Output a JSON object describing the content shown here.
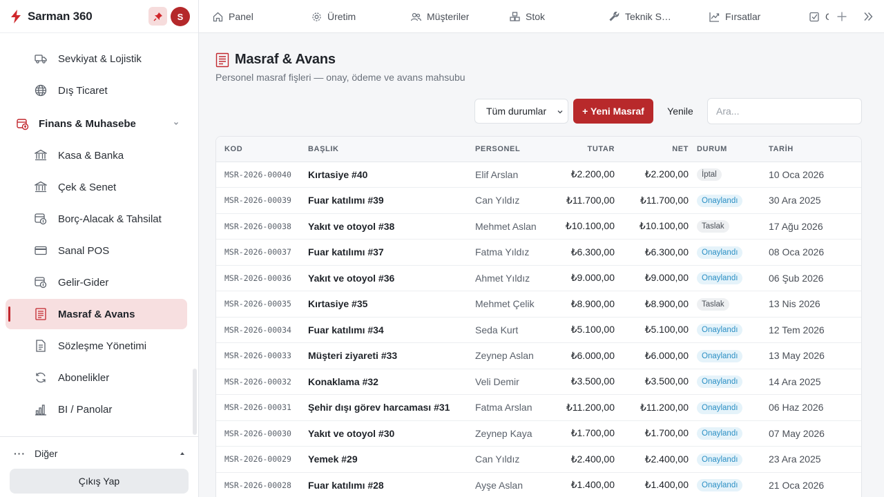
{
  "brand": {
    "name": "Sarman 360",
    "avatar_initial": "S"
  },
  "sidebar": {
    "items": [
      {
        "label": "Sevkiyat & Lojistik",
        "icon": "truck-icon"
      },
      {
        "label": "Dış Ticaret",
        "icon": "globe-icon"
      }
    ],
    "section": {
      "label": "Finans & Muhasebe",
      "icon": "finance-icon"
    },
    "sub_items": [
      {
        "label": "Kasa & Banka",
        "icon": "bank-icon"
      },
      {
        "label": "Çek & Senet",
        "icon": "bank-icon"
      },
      {
        "label": "Borç-Alacak & Tahsilat",
        "icon": "finance-icon"
      },
      {
        "label": "Sanal POS",
        "icon": "card-icon"
      },
      {
        "label": "Gelir-Gider",
        "icon": "finance-icon"
      },
      {
        "label": "Masraf & Avans",
        "icon": "receipt-icon",
        "active": true
      },
      {
        "label": "Sözleşme Yönetimi",
        "icon": "document-icon"
      },
      {
        "label": "Abonelikler",
        "icon": "refresh-icon"
      },
      {
        "label": "BI / Panolar",
        "icon": "bar-chart-icon"
      }
    ],
    "more_label": "Diğer",
    "logout_label": "Çıkış Yap"
  },
  "topbar": {
    "tabs": [
      {
        "label": "Panel",
        "icon": "home-icon"
      },
      {
        "label": "Üretim",
        "icon": "gear-icon"
      },
      {
        "label": "Müşteriler",
        "icon": "users-icon"
      },
      {
        "label": "Stok",
        "icon": "boxes-icon"
      },
      {
        "label": "Teknik S…",
        "icon": "wrench-icon"
      },
      {
        "label": "Fırsatlar",
        "icon": "trend-icon"
      },
      {
        "label": "G",
        "icon": "checkbox-icon"
      }
    ]
  },
  "page": {
    "title": "Masraf & Avans",
    "subtitle": "Personel masraf fişleri — onay, ödeme ve avans mahsubu",
    "filter_value": "Tüm durumlar",
    "new_button": "+ Yeni Masraf",
    "refresh_button": "Yenile",
    "search_placeholder": "Ara..."
  },
  "table": {
    "headers": [
      "KOD",
      "BAŞLIK",
      "PERSONEL",
      "TUTAR",
      "NET",
      "DURUM",
      "TARİH"
    ],
    "rows": [
      {
        "kod": "MSR-2026-00040",
        "baslik": "Kırtasiye #40",
        "personel": "Elif Arslan",
        "tutar": "₺2.200,00",
        "net": "₺2.200,00",
        "durum": "İptal",
        "tarih": "10 Oca 2026"
      },
      {
        "kod": "MSR-2026-00039",
        "baslik": "Fuar katılımı #39",
        "personel": "Can Yıldız",
        "tutar": "₺11.700,00",
        "net": "₺11.700,00",
        "durum": "Onaylandı",
        "tarih": "30 Ara 2025"
      },
      {
        "kod": "MSR-2026-00038",
        "baslik": "Yakıt ve otoyol #38",
        "personel": "Mehmet Aslan",
        "tutar": "₺10.100,00",
        "net": "₺10.100,00",
        "durum": "Taslak",
        "tarih": "17 Ağu 2026"
      },
      {
        "kod": "MSR-2026-00037",
        "baslik": "Fuar katılımı #37",
        "personel": "Fatma Yıldız",
        "tutar": "₺6.300,00",
        "net": "₺6.300,00",
        "durum": "Onaylandı",
        "tarih": "08 Oca 2026"
      },
      {
        "kod": "MSR-2026-00036",
        "baslik": "Yakıt ve otoyol #36",
        "personel": "Ahmet Yıldız",
        "tutar": "₺9.000,00",
        "net": "₺9.000,00",
        "durum": "Onaylandı",
        "tarih": "06 Şub 2026"
      },
      {
        "kod": "MSR-2026-00035",
        "baslik": "Kırtasiye #35",
        "personel": "Mehmet Çelik",
        "tutar": "₺8.900,00",
        "net": "₺8.900,00",
        "durum": "Taslak",
        "tarih": "13 Nis 2026"
      },
      {
        "kod": "MSR-2026-00034",
        "baslik": "Fuar katılımı #34",
        "personel": "Seda Kurt",
        "tutar": "₺5.100,00",
        "net": "₺5.100,00",
        "durum": "Onaylandı",
        "tarih": "12 Tem 2026"
      },
      {
        "kod": "MSR-2026-00033",
        "baslik": "Müşteri ziyareti #33",
        "personel": "Zeynep Aslan",
        "tutar": "₺6.000,00",
        "net": "₺6.000,00",
        "durum": "Onaylandı",
        "tarih": "13 May 2026"
      },
      {
        "kod": "MSR-2026-00032",
        "baslik": "Konaklama #32",
        "personel": "Veli Demir",
        "tutar": "₺3.500,00",
        "net": "₺3.500,00",
        "durum": "Onaylandı",
        "tarih": "14 Ara 2025"
      },
      {
        "kod": "MSR-2026-00031",
        "baslik": "Şehir dışı görev harcaması #31",
        "personel": "Fatma Arslan",
        "tutar": "₺11.200,00",
        "net": "₺11.200,00",
        "durum": "Onaylandı",
        "tarih": "06 Haz 2026"
      },
      {
        "kod": "MSR-2026-00030",
        "baslik": "Yakıt ve otoyol #30",
        "personel": "Zeynep Kaya",
        "tutar": "₺1.700,00",
        "net": "₺1.700,00",
        "durum": "Onaylandı",
        "tarih": "07 May 2026"
      },
      {
        "kod": "MSR-2026-00029",
        "baslik": "Yemek #29",
        "personel": "Can Yıldız",
        "tutar": "₺2.400,00",
        "net": "₺2.400,00",
        "durum": "Onaylandı",
        "tarih": "23 Ara 2025"
      },
      {
        "kod": "MSR-2026-00028",
        "baslik": "Fuar katılımı #28",
        "personel": "Ayşe Aslan",
        "tutar": "₺1.400,00",
        "net": "₺1.400,00",
        "durum": "Onaylandı",
        "tarih": "21 Oca 2026"
      }
    ]
  },
  "colors": {
    "accent": "#b8292b",
    "active_bg": "#f7dfe0",
    "badge_approved": "#2b8fc4"
  }
}
